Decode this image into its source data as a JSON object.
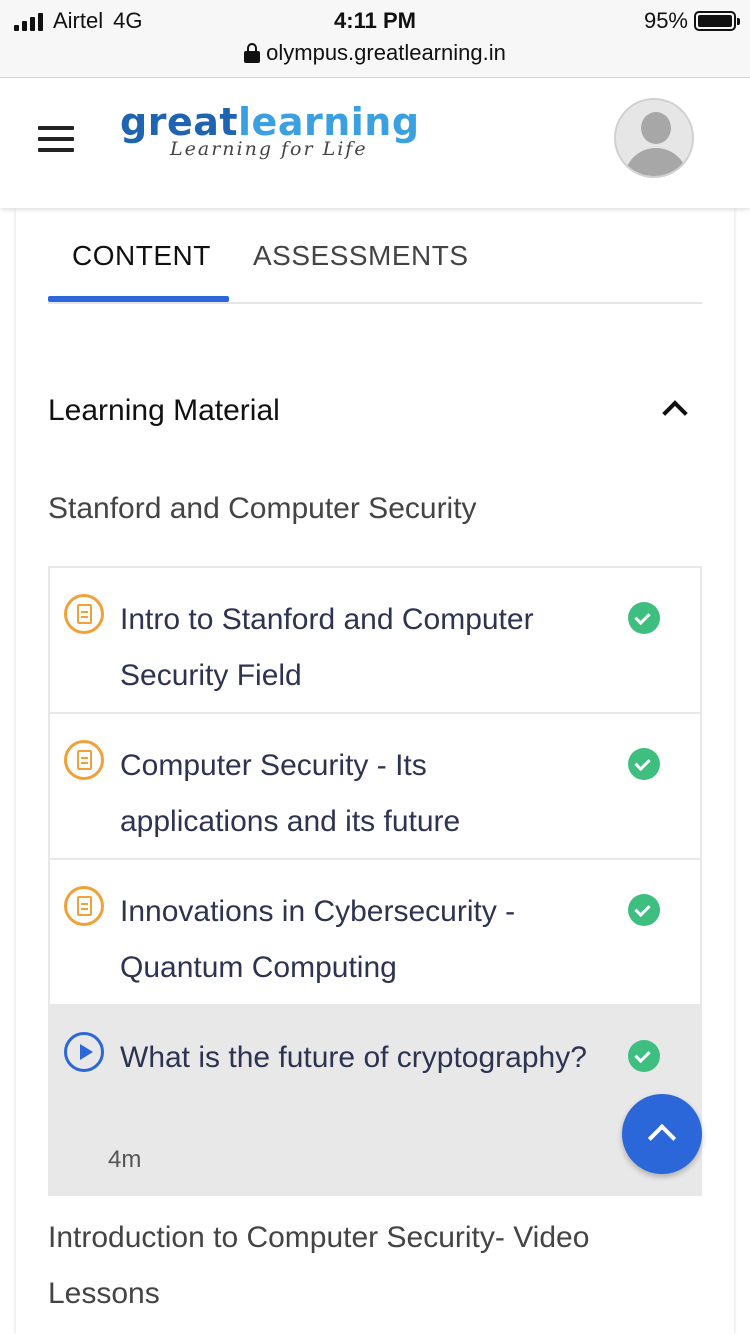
{
  "status_bar": {
    "carrier": "Airtel",
    "network": "4G",
    "time": "4:11 PM",
    "battery": "95%",
    "url": "olympus.greatlearning.in"
  },
  "header": {
    "logo_great": "great",
    "logo_learning": "learning",
    "logo_tagline": "Learning for Life"
  },
  "tabs": [
    {
      "label": "CONTENT",
      "active": true
    },
    {
      "label": "ASSESSMENTS",
      "active": false
    }
  ],
  "section": {
    "title": "Learning Material",
    "subsection": "Stanford and Computer Security",
    "items": [
      {
        "type": "document",
        "title": "Intro to Stanford and Computer Security Field",
        "completed": true
      },
      {
        "type": "document",
        "title": "Computer Security - Its applications and its future",
        "completed": true
      },
      {
        "type": "document",
        "title": "Innovations in Cybersecurity - Quantum Computing",
        "completed": true
      },
      {
        "type": "video",
        "title": "What is the future of cryptography?",
        "duration": "4m",
        "completed": true,
        "active": true
      }
    ],
    "next_subsection": "Introduction to Computer Security- Video Lessons"
  },
  "colors": {
    "accent": "#2b67d8",
    "doc_icon": "#f0a239",
    "check": "#3fbf7f",
    "logo_great": "#1f64b0",
    "logo_learning": "#3aa0e0"
  }
}
